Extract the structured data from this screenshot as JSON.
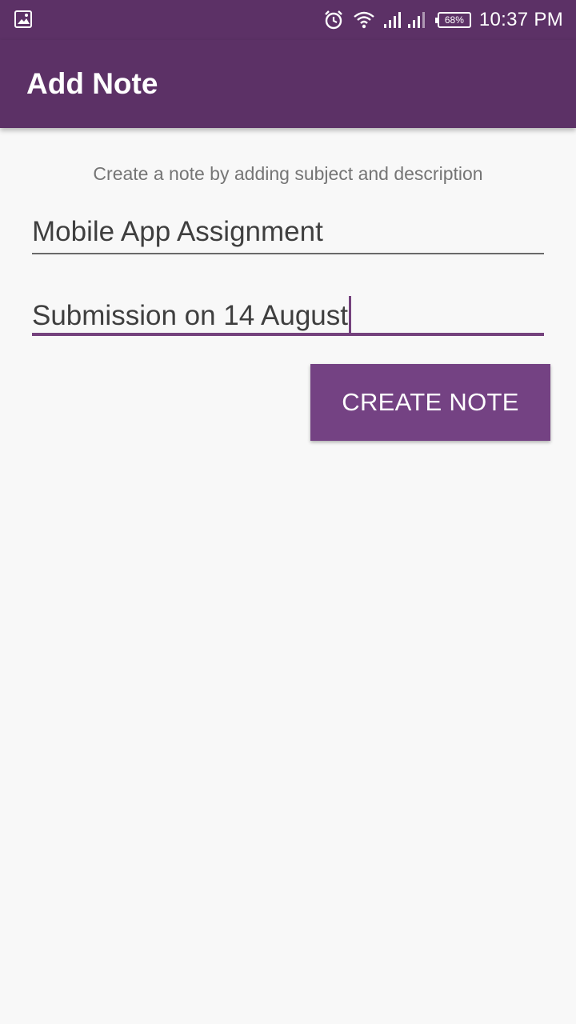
{
  "status_bar": {
    "left_icon": "image-icon",
    "icons": [
      "alarm-icon",
      "wifi-icon",
      "signal-icon",
      "signal-icon"
    ],
    "battery_percent": "68%",
    "time": "10:37 PM"
  },
  "app_bar": {
    "title": "Add Note",
    "color": "#5c3166"
  },
  "form": {
    "instructions": "Create a note by adding subject and description",
    "subject_value": "Mobile App Assignment",
    "description_value": "Submission on 14 August",
    "create_button_label": "CREATE NOTE",
    "accent_color": "#744283"
  }
}
